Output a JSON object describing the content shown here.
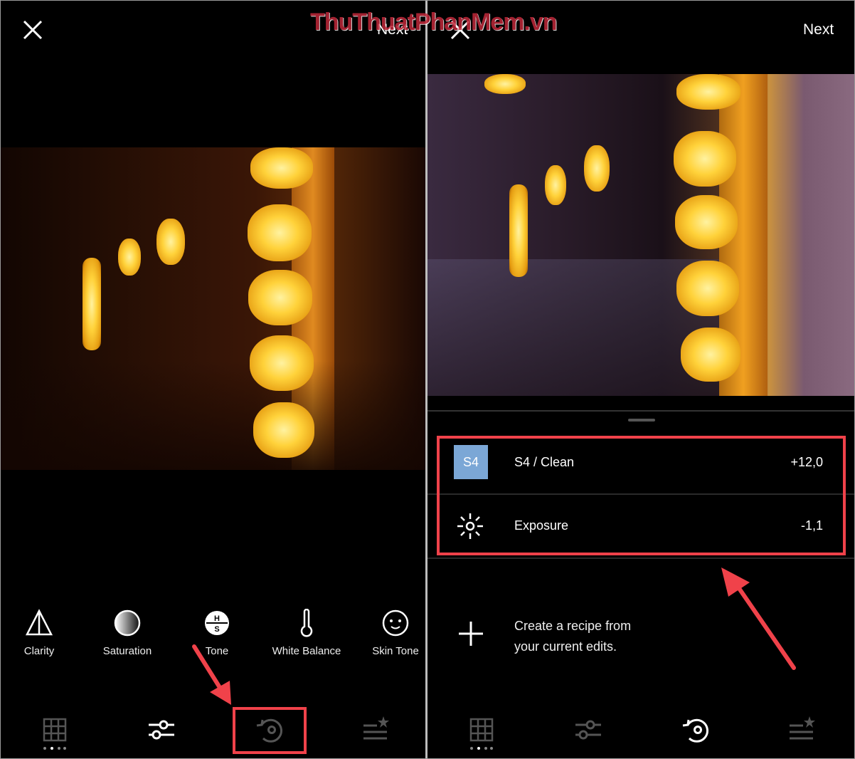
{
  "watermark": "ThuThuatPhanMem.vn",
  "left": {
    "next_label": "Next",
    "tools": [
      {
        "icon": "clarity-icon",
        "label": "Clarity"
      },
      {
        "icon": "saturation-icon",
        "label": "Saturation"
      },
      {
        "icon": "tone-icon",
        "label": "Tone",
        "glyph_top": "H",
        "glyph_bottom": "S"
      },
      {
        "icon": "white-balance-icon",
        "label": "White Balance"
      },
      {
        "icon": "skin-tone-icon",
        "label": "Skin Tone"
      }
    ],
    "nav": [
      "grid-icon",
      "sliders-icon",
      "history-icon",
      "recipes-icon"
    ],
    "active_nav": "sliders-icon",
    "highlighted_nav": "history-icon"
  },
  "right": {
    "next_label": "Next",
    "history": [
      {
        "badge": "S4",
        "badge_color": "#7ba7d6",
        "name": "S4 / Clean",
        "value": "+12,0"
      },
      {
        "icon": "exposure-icon",
        "name": "Exposure",
        "value": "-1,1"
      }
    ],
    "recipe_line1": "Create a recipe from",
    "recipe_line2": "your current edits.",
    "nav": [
      "grid-icon",
      "sliders-icon",
      "history-icon",
      "recipes-icon"
    ],
    "active_nav": "history-icon"
  },
  "colors": {
    "annotation": "#f0424a",
    "background": "#000000"
  }
}
